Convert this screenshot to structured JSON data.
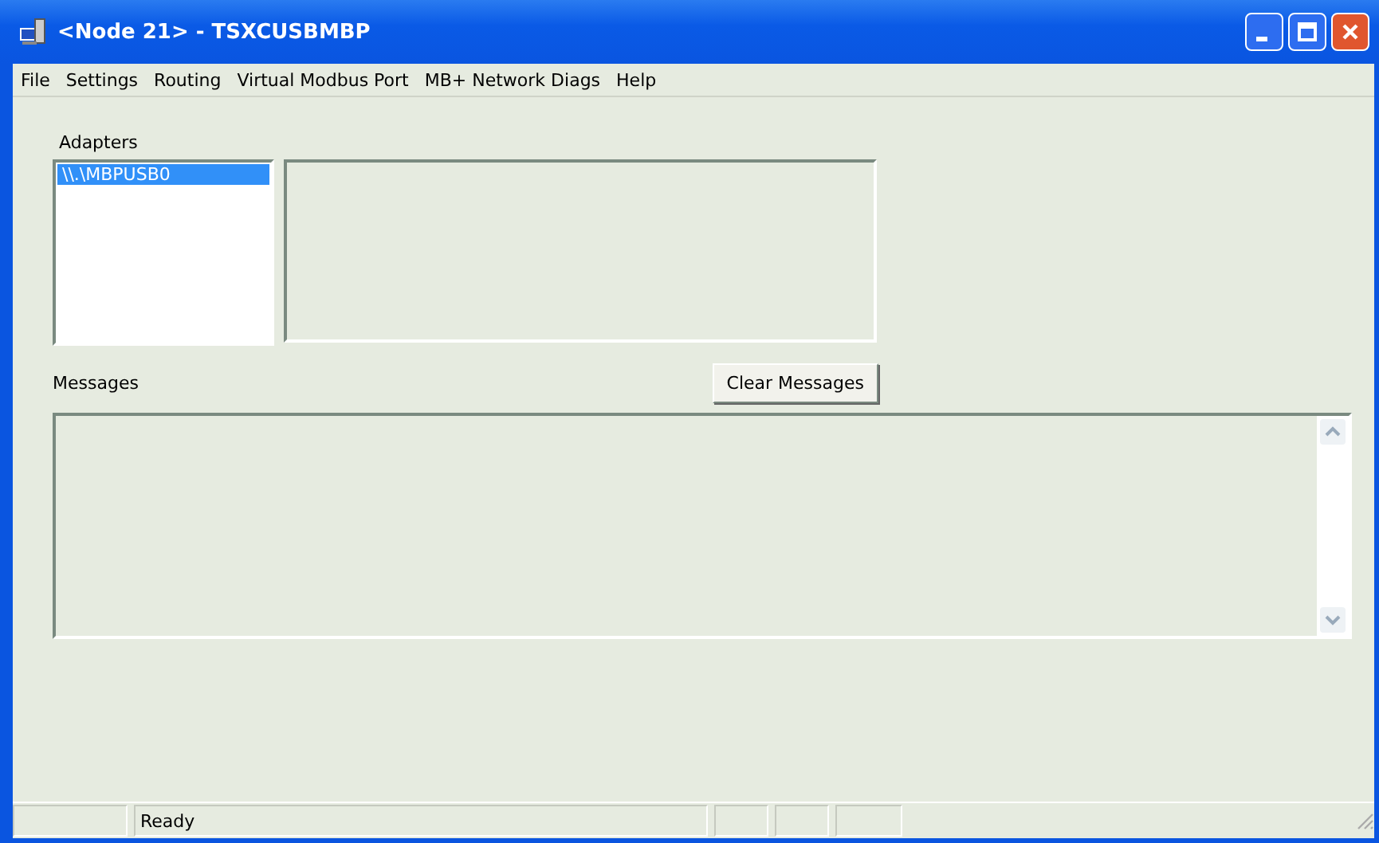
{
  "window": {
    "title": "<Node 21> - TSXCUSBMBP"
  },
  "menu": [
    "File",
    "Settings",
    "Routing",
    "Virtual Modbus Port",
    "MB+ Network Diags",
    "Help"
  ],
  "adapters": {
    "label": "Adapters",
    "items": [
      {
        "name": "\\\\.\\MBPUSB0",
        "selected": true
      }
    ]
  },
  "messages": {
    "label": "Messages",
    "button": "Clear Messages"
  },
  "status_bar": {
    "text": "Ready"
  }
}
